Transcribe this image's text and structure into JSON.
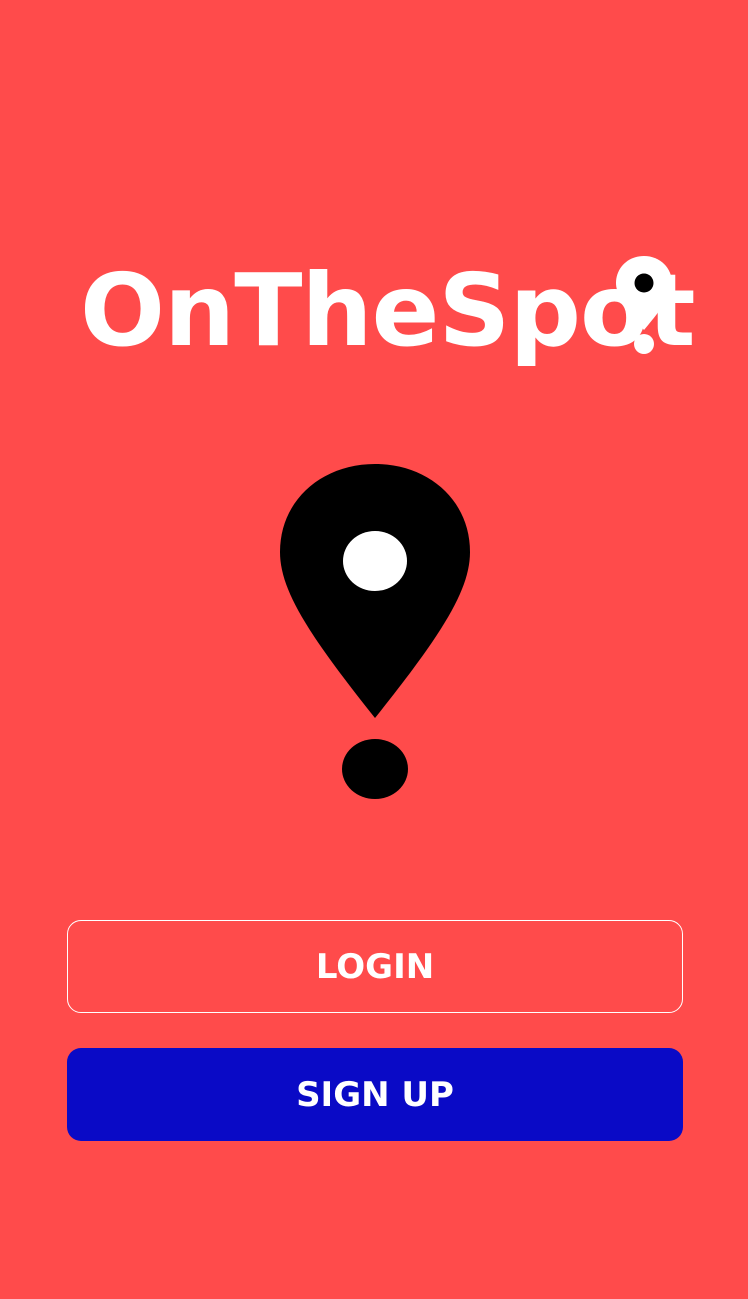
{
  "app": {
    "name": "OnTheSpot"
  },
  "actions": {
    "login_label": "LOGIN",
    "signup_label": "SIGN UP"
  },
  "icons": {
    "logo_pin": "map-pin-icon",
    "hero_pin": "map-pin-icon"
  },
  "colors": {
    "background": "#FF4B4B",
    "primary_button": "#0A0AC6",
    "text": "#FFFFFF",
    "pin": "#000000"
  }
}
